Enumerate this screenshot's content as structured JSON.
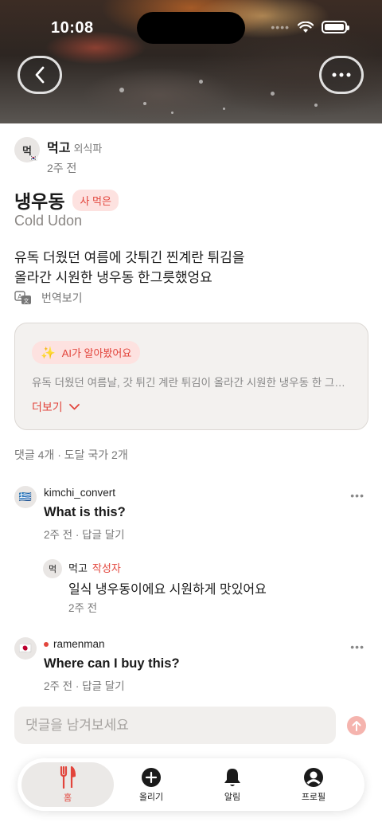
{
  "status_bar": {
    "time": "10:08"
  },
  "author": {
    "avatar_text": "먹",
    "name": "먹고",
    "tag": "외식파",
    "time": "2주 전"
  },
  "post": {
    "title": "냉우동",
    "badge": "사 먹은",
    "subtitle": "Cold Udon",
    "body_line1": "유독 더웠던 여름에 갓튀긴 찐계란 튀김을",
    "body_line2": "올라간 시원한 냉우동 한그릇했엉요",
    "translate_label": "번역보기"
  },
  "ai_card": {
    "label": "AI가 알아봤어요",
    "summary": "유독 더웠던 여름날, 갓 튀긴 계란 튀김이 올라간 시원한 냉우동 한 그…",
    "more_label": "더보기"
  },
  "comment_count": "댓글 4개 · 도달 국가 2개",
  "comments": [
    {
      "user": "kimchi_convert",
      "flag": "🇬🇷",
      "text": "What is this?",
      "time": "2주 전",
      "reply_label": "답글 달기"
    },
    {
      "user": "ramenman",
      "flag": "🇯🇵",
      "text": "Where can I buy this?",
      "time": "2주 전",
      "reply_label": "답글 달기"
    }
  ],
  "reply": {
    "avatar_text": "먹",
    "user": "먹고",
    "author_label": "작성자",
    "text": "일식 냉우동이에요 시원하게 맛있어요",
    "time": "2주 전"
  },
  "input": {
    "placeholder": "댓글을 남겨보세요"
  },
  "tabs": [
    {
      "label": "홈",
      "active": true
    },
    {
      "label": "올리기"
    },
    {
      "label": "알림"
    },
    {
      "label": "프로필"
    }
  ],
  "colors": {
    "accent": "#e2453c",
    "badge_bg": "#fde2e0",
    "card_bg": "#f3f1ef"
  },
  "icons": [
    "back-arrow-icon",
    "more-horizontal-icon",
    "translate-icon",
    "sparkle-icon",
    "chevron-down-icon",
    "send-arrow-icon",
    "fork-knife-icon",
    "plus-circle-icon",
    "bell-icon",
    "profile-icon"
  ]
}
